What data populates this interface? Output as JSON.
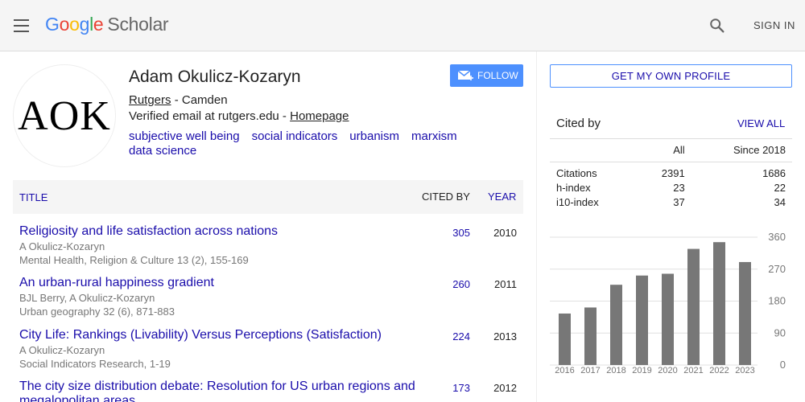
{
  "header": {
    "logo": {
      "g1": "G",
      "g2": "o",
      "g3": "o",
      "g4": "g",
      "g5": "l",
      "g6": "e",
      "scholar": "Scholar"
    },
    "sign_in": "SIGN IN",
    "icons": [
      "menu-icon",
      "search-icon"
    ]
  },
  "profile": {
    "avatar_text": "AOK",
    "name": "Adam Okulicz-Kozaryn",
    "affiliation_link": "Rutgers",
    "affiliation_rest": " - Camden",
    "verified": "Verified email at rutgers.edu - ",
    "homepage": "Homepage",
    "interests": [
      "subjective well being",
      "social indicators",
      "urbanism",
      "marxism",
      "data science"
    ],
    "follow_label": "FOLLOW"
  },
  "table": {
    "col_title": "TITLE",
    "col_cited": "CITED BY",
    "col_year": "YEAR",
    "rows": [
      {
        "title": "Religiosity and life satisfaction across nations",
        "authors": "A Okulicz-Kozaryn",
        "venue": "Mental Health, Religion & Culture 13 (2), 155-169",
        "cited": "305",
        "year": "2010"
      },
      {
        "title": "An urban-rural happiness gradient",
        "authors": "BJL Berry, A Okulicz-Kozaryn",
        "venue": "Urban geography 32 (6), 871-883",
        "cited": "260",
        "year": "2011"
      },
      {
        "title": "City Life: Rankings (Livability) Versus Perceptions (Satisfaction)",
        "authors": "A Okulicz-Kozaryn",
        "venue": "Social Indicators Research, 1-19",
        "cited": "224",
        "year": "2013"
      },
      {
        "title": "The city size distribution debate: Resolution for US urban regions and megalopolitan areas",
        "authors": "",
        "venue": "",
        "cited": "173",
        "year": "2012"
      }
    ]
  },
  "sidebar": {
    "own_profile": "GET MY OWN PROFILE",
    "cited_by": "Cited by",
    "view_all": "VIEW ALL",
    "stats_header": [
      "",
      "All",
      "Since 2018"
    ],
    "stats": [
      {
        "label": "Citations",
        "all": "2391",
        "since": "1686"
      },
      {
        "label": "h-index",
        "all": "23",
        "since": "22"
      },
      {
        "label": "i10-index",
        "all": "37",
        "since": "34"
      }
    ]
  },
  "chart_data": {
    "type": "bar",
    "categories": [
      "2016",
      "2017",
      "2018",
      "2019",
      "2020",
      "2021",
      "2022",
      "2023"
    ],
    "values": [
      145,
      162,
      226,
      252,
      257,
      327,
      346,
      290
    ],
    "ylim": [
      0,
      360
    ],
    "yticks": [
      0,
      90,
      180,
      270,
      360
    ],
    "grid": true
  },
  "colors": {
    "link": "#1a0dab",
    "follow": "#4d90fe",
    "bar": "#777777",
    "header_bg": "#f5f5f5"
  }
}
